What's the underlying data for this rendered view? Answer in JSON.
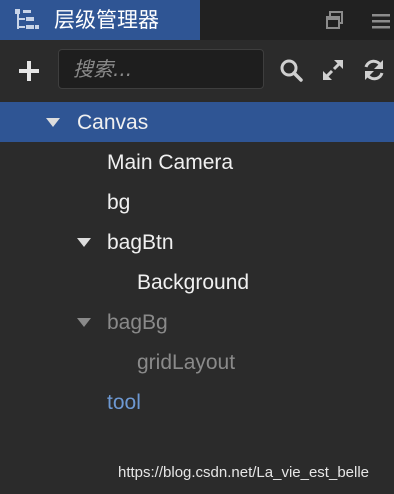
{
  "panel": {
    "title": "层级管理器",
    "icon": "hierarchy-icon"
  },
  "toolbar": {
    "search_placeholder": "搜索..."
  },
  "tree": {
    "nodes": [
      {
        "label": "Canvas",
        "expanded": true,
        "selected": true,
        "state": "normal"
      },
      {
        "label": "Main Camera",
        "state": "normal"
      },
      {
        "label": "bg",
        "state": "normal"
      },
      {
        "label": "bagBtn",
        "expanded": true,
        "state": "normal"
      },
      {
        "label": "Background",
        "state": "normal"
      },
      {
        "label": "bagBg",
        "expanded": true,
        "state": "inactive"
      },
      {
        "label": "gridLayout",
        "state": "inactive"
      },
      {
        "label": "tool",
        "state": "prefab"
      }
    ]
  },
  "watermark": "https://blog.csdn.net/La_vie_est_belle",
  "colors": {
    "accent": "#2f5594",
    "background": "#2b2b2b",
    "text": "#f0f0f0",
    "inactive_text": "#8a8a8a",
    "prefab_text": "#6d98d2"
  }
}
